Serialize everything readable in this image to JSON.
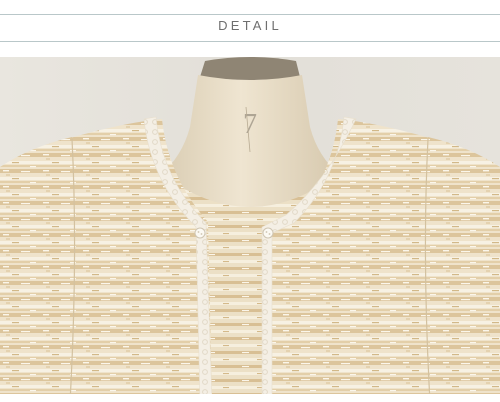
{
  "header": {
    "title": "DETAIL"
  },
  "photo": {
    "subject": "cream-tweed-cardigan-detail",
    "mannequin_marking": "7"
  },
  "colors": {
    "rule": "#b9c7c9",
    "title_text": "#6f6f6f",
    "backdrop": "#e4e1da",
    "tweed_base": "#eee1c8",
    "tweed_stripe": "#dcc49a",
    "tweed_sparkle": "#f7f2e4",
    "lace_trim": "#f6f2ea",
    "mannequin": "#eadfc9",
    "mannequin_cap": "#8f8574"
  }
}
